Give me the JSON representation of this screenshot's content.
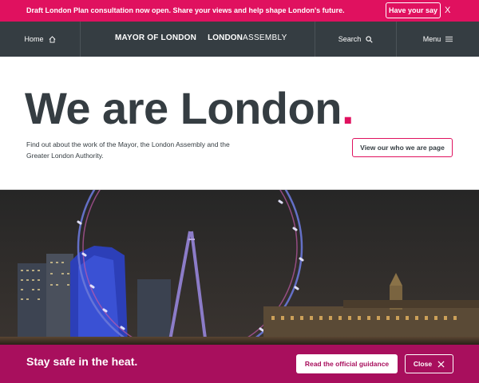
{
  "banner": {
    "text": "Draft London Plan consultation now open. Share your views and help shape London's future.",
    "button": "Have your say",
    "close": "X",
    "color": "#e0115f"
  },
  "nav": {
    "home": "Home",
    "mayor_logo": "MAYOR OF LONDON",
    "assembly_logo_bold": "LONDON",
    "assembly_logo_light": "ASSEMBLY",
    "search": "Search",
    "menu": "Menu",
    "background": "#353d42"
  },
  "hero": {
    "title": "We are London",
    "title_dot": ".",
    "description": "Find out about the work of the Mayor, the London Assembly and the Greater London Authority.",
    "cta": "View our who we are page"
  },
  "photo": {
    "subject": "London Eye at night"
  },
  "heat_bar": {
    "title": "Stay safe in the heat.",
    "guidance_button": "Read the official guidance",
    "close_button": "Close",
    "color": "#a80f5d"
  }
}
